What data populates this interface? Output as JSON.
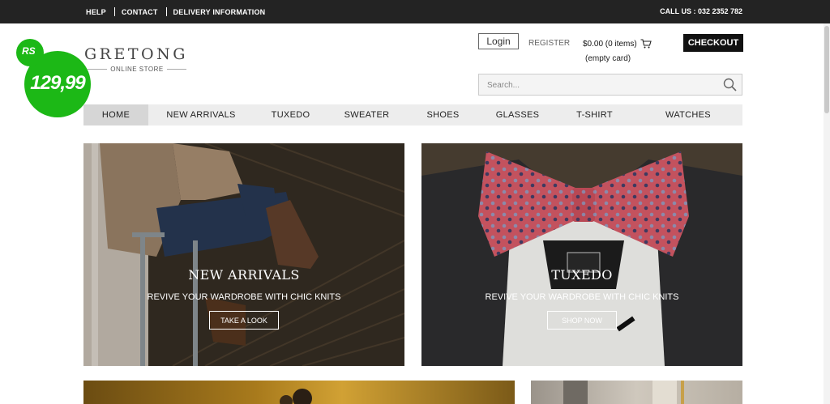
{
  "topbar": {
    "links": [
      "HELP",
      "CONTACT",
      "DELIVERY INFORMATION"
    ],
    "call": "CALL US : 032 2352 782"
  },
  "badge": {
    "currency": "RS",
    "amount": "129,99"
  },
  "logo": {
    "name": "GRETONG",
    "tagline": "ONLINE STORE"
  },
  "header": {
    "login": "Login",
    "register": "REGISTER",
    "cart_total": "$0.00 (0 items)",
    "cart_sub": "(empty card)",
    "checkout": "CHECKOUT",
    "search_placeholder": "Search..."
  },
  "nav": [
    "HOME",
    "NEW ARRIVALS",
    "TUXEDO",
    "SWEATER",
    "SHOES",
    "GLASSES",
    "T-SHIRT",
    "WATCHES"
  ],
  "banners": [
    {
      "title": "NEW ARRIVALS",
      "subtitle": "REVIVE YOUR WARDROBE WITH CHIC KNITS",
      "cta": "TAKE A LOOK"
    },
    {
      "title": "TUXEDO",
      "subtitle": "REVIVE YOUR WARDROBE WITH CHIC KNITS",
      "cta": "SHOP NOW"
    }
  ],
  "colors": {
    "topbar": "#232323",
    "badge": "#1cb816",
    "checkout": "#111111"
  }
}
